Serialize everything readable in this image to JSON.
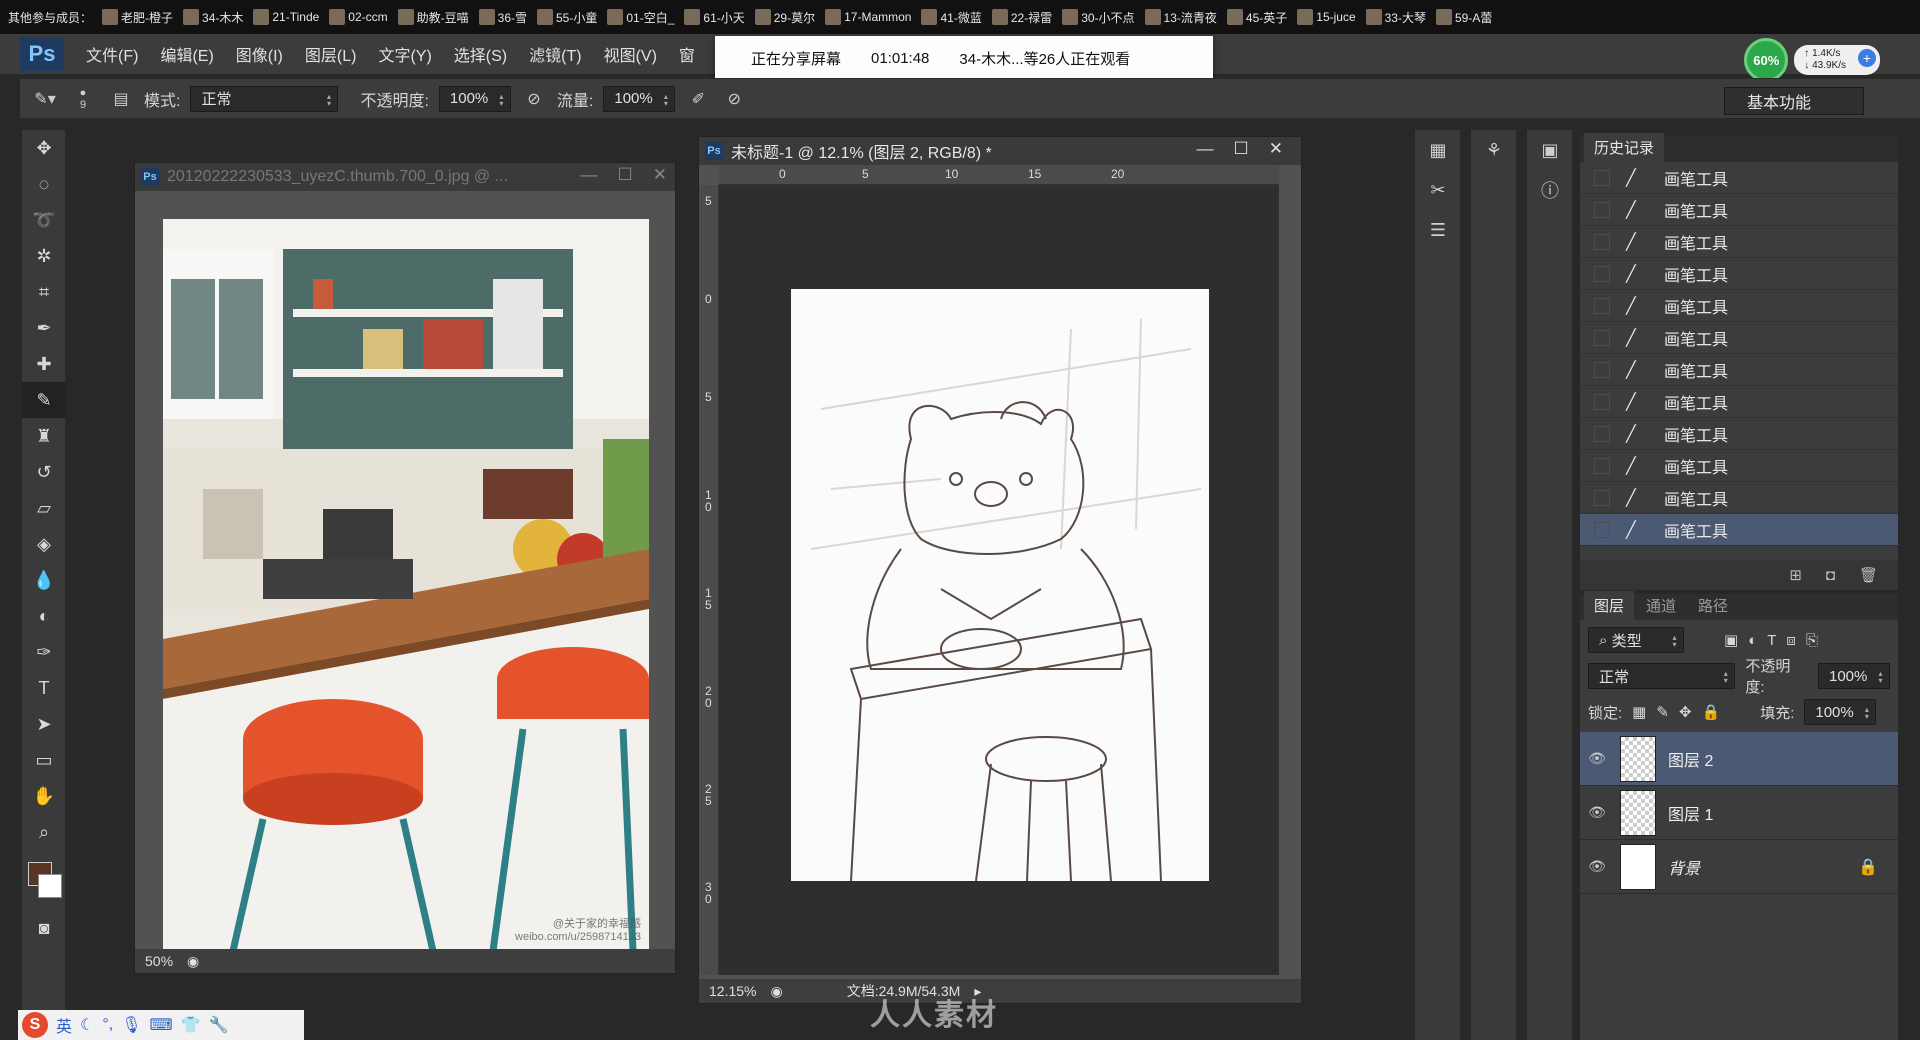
{
  "participants": {
    "lead": "其他参与成员：",
    "items": [
      "老肥-橙子",
      "34-木木",
      "21-Tinde",
      "02-ccm",
      "助教-豆喵",
      "36-雪",
      "55-小童",
      "01-空白_",
      "61-小天",
      "29-莫尔",
      "17-Mammon",
      "41-微蓝",
      "22-禄雷",
      "30-小不点",
      "13-流青夜",
      "45-英子",
      "15-juce",
      "33-大琴",
      "59-A蕾"
    ]
  },
  "menubar": {
    "logo": "Ps",
    "items": [
      "文件(F)",
      "编辑(E)",
      "图像(I)",
      "图层(L)",
      "文字(Y)",
      "选择(S)",
      "滤镜(T)",
      "视图(V)",
      "窗"
    ]
  },
  "share_banner": {
    "status": "正在分享屏幕",
    "timer": "01:01:48",
    "viewers": "34-木木...等26人正在观看"
  },
  "perf": {
    "percent": "60%",
    "up": "1.4K/s",
    "down": "43.9K/s",
    "plus": "+"
  },
  "options": {
    "brush_size": "9",
    "mode_label": "模式:",
    "mode_value": "正常",
    "opacity_label": "不透明度:",
    "opacity_value": "100%",
    "flow_label": "流量:",
    "flow_value": "100%",
    "workspace": "基本功能"
  },
  "doc1": {
    "title": "20120222230533_uyezC.thumb.700_0.jpg @ ...",
    "zoom": "50%",
    "photo_watermark": "@关于家的幸福感\nweibo.com/u/2598714133"
  },
  "doc2": {
    "title": "未标题-1 @ 12.1% (图层 2, RGB/8) *",
    "zoom": "12.15%",
    "doc_size": "文档:24.9M/54.3M",
    "ruler_h": [
      "0",
      "5",
      "10",
      "15",
      "20"
    ],
    "ruler_v": [
      "5",
      "0",
      "5",
      "1\n0",
      "1\n5",
      "2\n0",
      "2\n5",
      "3\n0"
    ]
  },
  "history": {
    "tab": "历史记录",
    "items": [
      "画笔工具",
      "画笔工具",
      "画笔工具",
      "画笔工具",
      "画笔工具",
      "画笔工具",
      "画笔工具",
      "画笔工具",
      "画笔工具",
      "画笔工具",
      "画笔工具",
      "画笔工具"
    ]
  },
  "layers": {
    "tabs": [
      "图层",
      "通道",
      "路径"
    ],
    "filter": "类型",
    "blend": "正常",
    "opacity_label": "不透明度:",
    "opacity_value": "100%",
    "lock_label": "锁定:",
    "fill_label": "填充:",
    "fill_value": "100%",
    "items": [
      {
        "name": "图层 2"
      },
      {
        "name": "图层 1"
      },
      {
        "name": "背景"
      }
    ]
  },
  "ime": {
    "logo": "S",
    "lang": "英"
  },
  "watermark": "人人素材"
}
